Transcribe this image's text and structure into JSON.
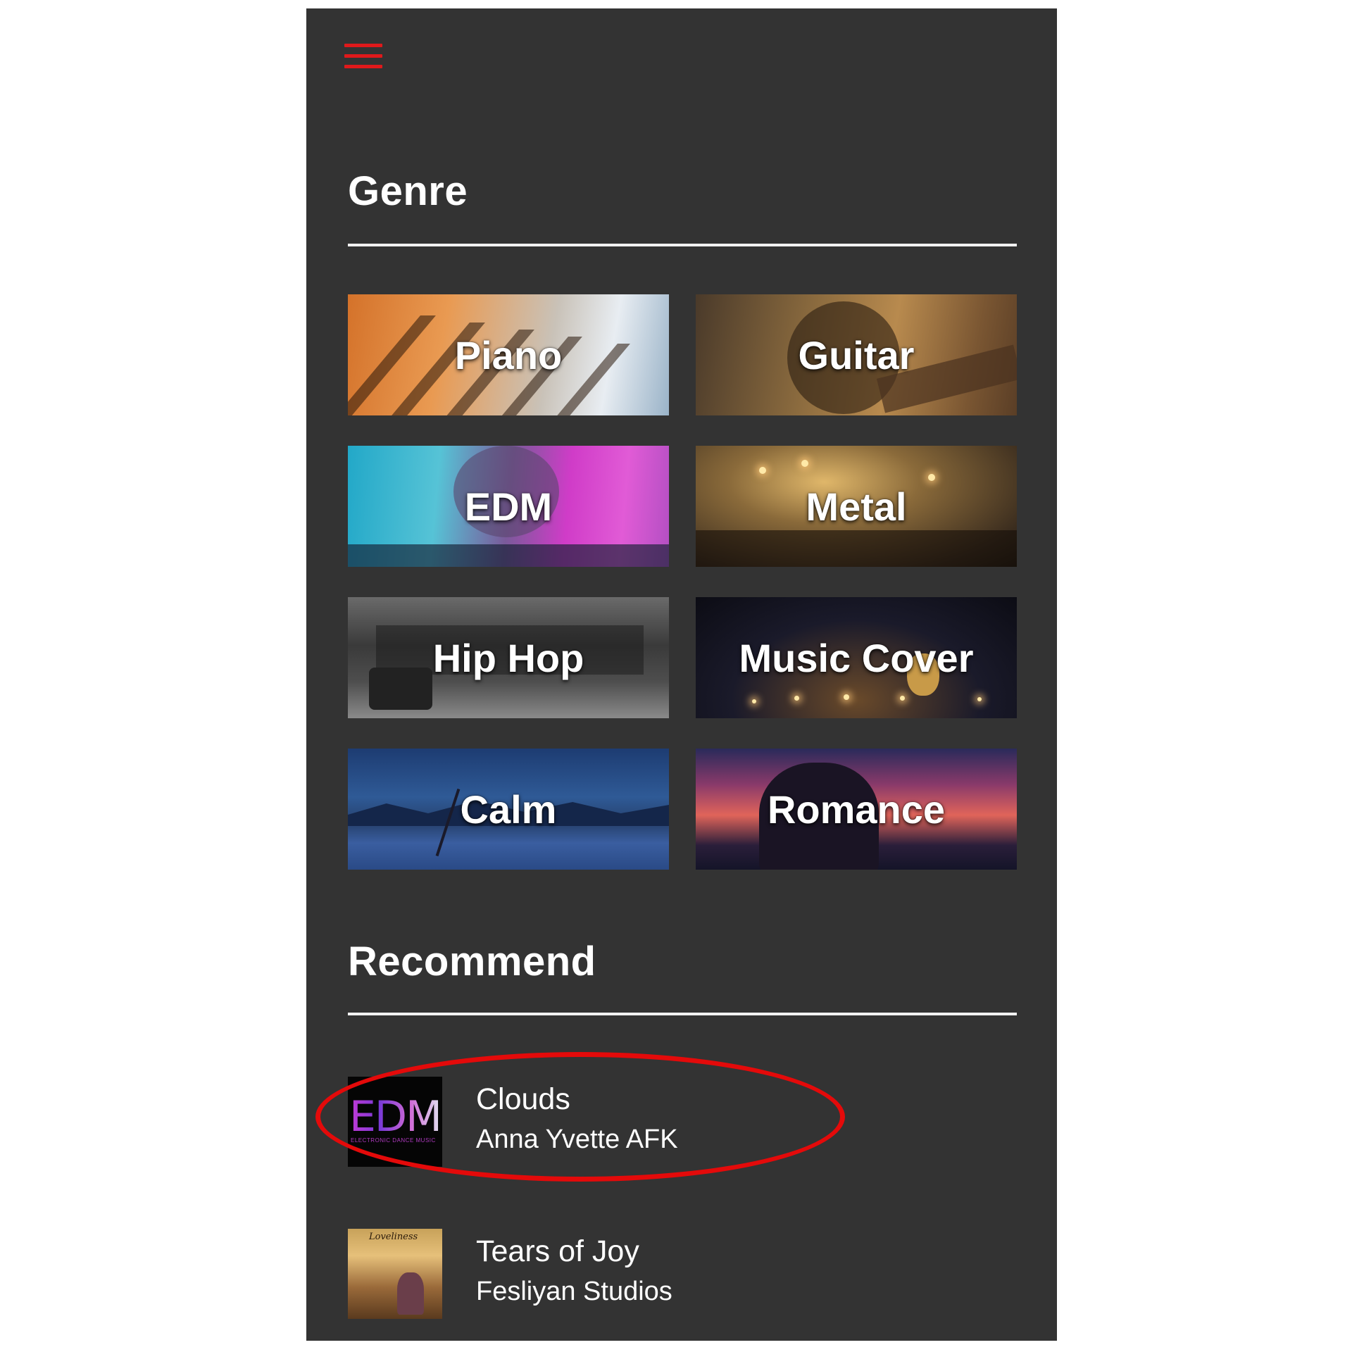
{
  "header": {
    "menu_icon": "hamburger-menu-icon",
    "accent_color": "#e0191b"
  },
  "genre": {
    "title": "Genre",
    "tiles": [
      {
        "label": "Piano"
      },
      {
        "label": "Guitar"
      },
      {
        "label": "EDM"
      },
      {
        "label": "Metal"
      },
      {
        "label": "Hip Hop"
      },
      {
        "label": "Music Cover"
      },
      {
        "label": "Calm"
      },
      {
        "label": "Romance"
      }
    ]
  },
  "recommend": {
    "title": "Recommend",
    "tracks": [
      {
        "title": "Clouds",
        "artist": "Anna Yvette AFK",
        "cover_text": "EDM",
        "cover_subtext": "ELECTRONIC DANCE MUSIC"
      },
      {
        "title": "Tears of Joy",
        "artist": "Fesliyan Studios",
        "cover_text": "Loveliness"
      }
    ]
  },
  "annotation": {
    "highlight_color": "#e40a0a"
  }
}
